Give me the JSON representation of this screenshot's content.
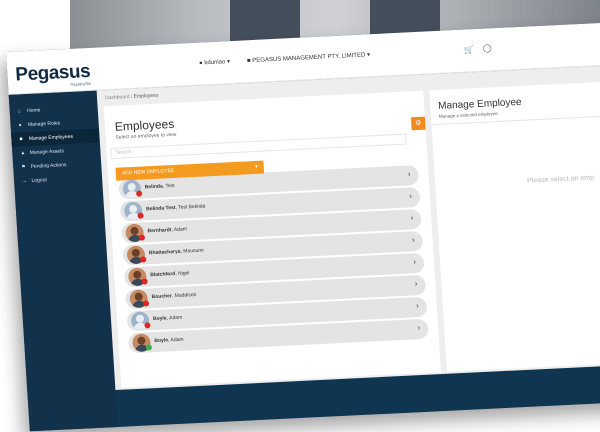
{
  "app": {
    "logo": "Pegasus",
    "tagline": "Regulating Risk"
  },
  "topbar": {
    "user": "kdunlao",
    "company": "PEGASUS MANAGEMENT PTY. LIMITED",
    "cart_icon": "cart-icon",
    "bell_icon": "bell-icon"
  },
  "sidebar": {
    "items": [
      {
        "label": "Home",
        "icon": "home-icon"
      },
      {
        "label": "Manage Roles",
        "icon": "users-icon"
      },
      {
        "label": "Manage Employees",
        "icon": "employee-icon",
        "active": true
      },
      {
        "label": "Manage Assets",
        "icon": "asset-icon"
      },
      {
        "label": "Pending Actions",
        "icon": "pending-icon"
      },
      {
        "label": "Logout",
        "icon": "logout-icon"
      }
    ]
  },
  "breadcrumb": {
    "root": "Dashboard",
    "separator": "/",
    "current": "Employees"
  },
  "employees": {
    "title": "Employees",
    "subtitle": "Select an employee to view",
    "search_placeholder": "Search",
    "add_label": "ADD NEW EMPLOYEE",
    "rows": [
      {
        "last": "Belinda",
        "first": "Test",
        "photo": false,
        "status": "error"
      },
      {
        "last": "Belinda Test",
        "first": "Test Belinda",
        "photo": false,
        "status": "error"
      },
      {
        "last": "Bernhardt",
        "first": "Adam",
        "photo": true,
        "status": "error"
      },
      {
        "last": "Bhattacharya",
        "first": "Mousumi",
        "photo": true,
        "status": "error"
      },
      {
        "last": "Blatchford",
        "first": "Nigel",
        "photo": true,
        "status": "error"
      },
      {
        "last": "Boucher",
        "first": "Maddison",
        "photo": true,
        "status": "error"
      },
      {
        "last": "Boyle",
        "first": "Adam",
        "photo": false,
        "status": "error"
      },
      {
        "last": "Boyle",
        "first": "Adam",
        "photo": true,
        "status": "ok"
      }
    ]
  },
  "manage": {
    "title": "Manage Employee",
    "subtitle": "Manage a selected employee",
    "placeholder": "Please select an emp"
  },
  "colors": {
    "accent": "#f39a1f",
    "sidebar": "#12324c",
    "frame": "#0f3550",
    "badge_error": "#e02525",
    "badge_ok": "#3cae4a"
  }
}
